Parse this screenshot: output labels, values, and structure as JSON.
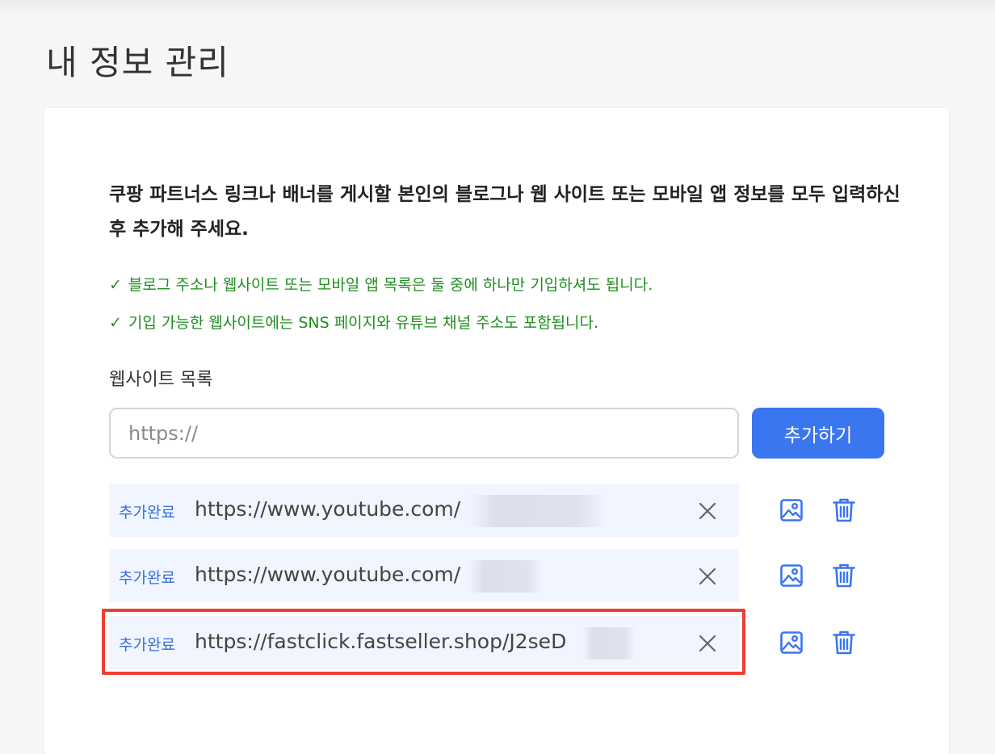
{
  "page": {
    "title": "내 정보 관리"
  },
  "intro": {
    "text": "쿠팡 파트너스 링크나 배너를 게시할 본인의 블로그나 웹 사이트 또는 모바일 앱 정보를 모두 입력하신 후 추가해 주세요."
  },
  "notes": [
    {
      "check": "✓",
      "text": "블로그 주소나 웹사이트 또는 모바일 앱 목록은 둘 중에 하나만 기입하셔도 됩니다."
    },
    {
      "check": "✓",
      "text": "기입 가능한 웹사이트에는 SNS 페이지와 유튜브 채널 주소도 포함됩니다."
    }
  ],
  "website_section": {
    "label": "웹사이트 목록",
    "input_placeholder": "https://",
    "input_value": "",
    "add_button_label": "추가하기"
  },
  "sites": [
    {
      "status": "추가완료",
      "url": "https://www.youtube.com/"
    },
    {
      "status": "추가완료",
      "url": "https://www.youtube.com/"
    },
    {
      "status": "추가완료",
      "url": "https://fastclick.fastseller.shop/J2seD"
    }
  ],
  "icons": {
    "check": "check-icon",
    "remove": "close-icon",
    "image": "image-icon",
    "delete": "trash-icon"
  },
  "colors": {
    "accent": "#3a76f0",
    "note_green": "#1e8e1e",
    "row_bg": "#f0f5ff",
    "highlight": "#ef3e33"
  }
}
